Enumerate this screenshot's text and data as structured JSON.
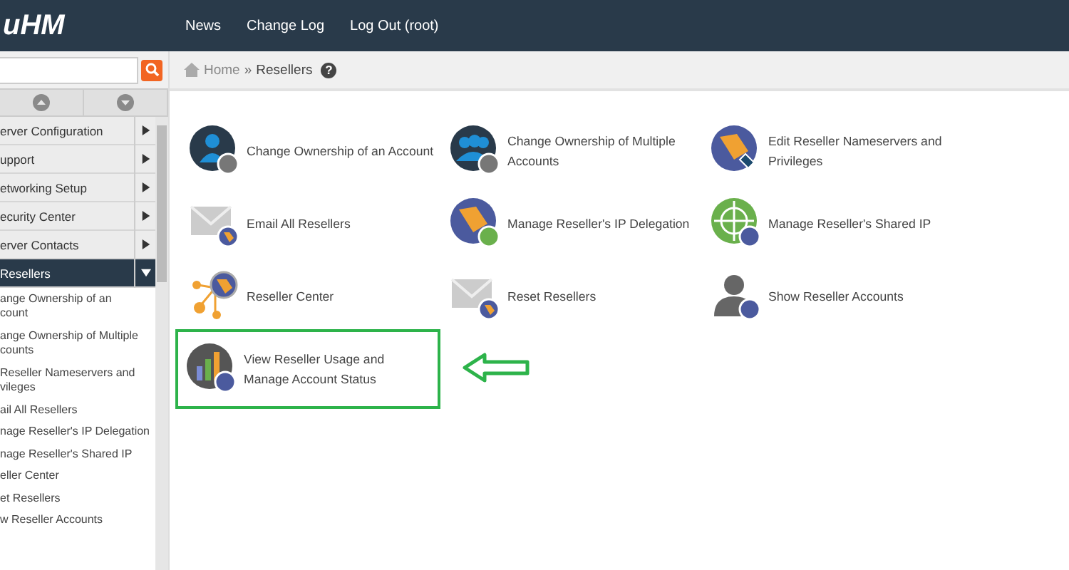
{
  "header": {
    "logo": "uHM",
    "nav": [
      "News",
      "Change Log",
      "Log Out (root)"
    ]
  },
  "breadcrumb": {
    "home": "Home",
    "separator": "»",
    "current": "Resellers",
    "help": "?"
  },
  "sidebar": {
    "items": [
      {
        "label": "erver Configuration",
        "expanded": false
      },
      {
        "label": "upport",
        "expanded": false
      },
      {
        "label": "etworking Setup",
        "expanded": false
      },
      {
        "label": "ecurity Center",
        "expanded": false
      },
      {
        "label": "erver Contacts",
        "expanded": false
      },
      {
        "label": "Resellers",
        "expanded": true,
        "children": [
          {
            "lines": [
              "ange Ownership of an",
              "count"
            ]
          },
          {
            "lines": [
              "ange Ownership of Multiple",
              "counts"
            ]
          },
          {
            "lines": [
              "Reseller Nameservers and",
              "vileges"
            ]
          },
          {
            "lines": [
              "ail All Resellers"
            ]
          },
          {
            "lines": [
              "nage Reseller's IP Delegation"
            ]
          },
          {
            "lines": [
              "nage Reseller's Shared IP"
            ]
          },
          {
            "lines": [
              "eller Center"
            ]
          },
          {
            "lines": [
              "et Resellers"
            ]
          },
          {
            "lines": [
              "w Reseller Accounts"
            ]
          }
        ]
      }
    ]
  },
  "tools": [
    {
      "label": "Change Ownership of an Account",
      "highlighted": false
    },
    {
      "label": "Change Ownership of Multiple Accounts",
      "highlighted": false
    },
    {
      "label": "Edit Reseller Nameservers and Privileges",
      "highlighted": false
    },
    {
      "label": "Email All Resellers",
      "highlighted": false
    },
    {
      "label": "Manage Reseller's IP Delegation",
      "highlighted": false
    },
    {
      "label": "Manage Reseller's Shared IP",
      "highlighted": false
    },
    {
      "label": "Reseller Center",
      "highlighted": false
    },
    {
      "label": "Reset Resellers",
      "highlighted": false
    },
    {
      "label": "Show Reseller Accounts",
      "highlighted": false
    },
    {
      "label": "View Reseller Usage and Manage Account Status",
      "highlighted": true
    }
  ]
}
